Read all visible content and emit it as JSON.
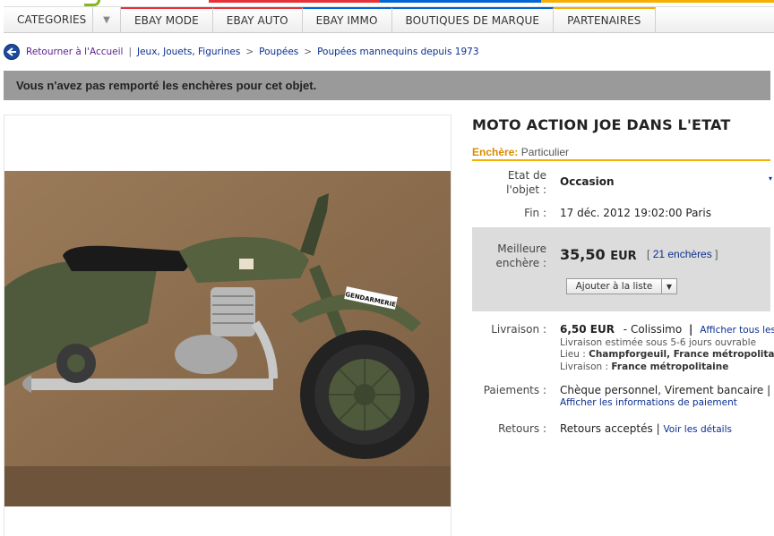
{
  "colors": {
    "ebay_red": "#e53238",
    "ebay_blue": "#0064d2",
    "ebay_yellow": "#f5af02",
    "ebay_green": "#86b817",
    "status_bar": "#9a9a9a",
    "bid_panel": "#dcdcdc",
    "link": "#0b2f8f"
  },
  "nav": {
    "categories": "CATEGORIES",
    "items": [
      "EBAY MODE",
      "EBAY AUTO",
      "EBAY IMMO",
      "BOUTIQUES DE MARQUE",
      "PARTENAIRES"
    ]
  },
  "breadcrumb": {
    "back_label": "Retourner à l'Accueil",
    "separator": ">",
    "path": [
      "Jeux, Jouets, Figurines",
      "Poupées",
      "Poupées mannequins depuis 1973"
    ]
  },
  "status_message": "Vous n'avez pas remporté les enchères pour cet objet.",
  "item": {
    "title": "MOTO ACTION JOE DANS L'ETAT",
    "seller_label": "Enchère:",
    "seller_type": "Particulier",
    "condition_label": "Etat de l'objet :",
    "condition": "Occasion",
    "end_label": "Fin :",
    "end_date": "17 déc. 2012 19:02:00 Paris",
    "best_bid_label": "Meilleure enchère :",
    "price": "35,50",
    "currency": "EUR",
    "bid_count_prefix": "[",
    "bid_count": "21 enchères",
    "bid_count_suffix": "]",
    "watch_button": "Ajouter à la liste",
    "shipping_label": "Livraison :",
    "shipping_cost": "6,50 EUR",
    "shipping_method": "- Colissimo",
    "shipping_sep": "|",
    "shipping_all": "Afficher tous les",
    "shipping_estimate": "Livraison estimée sous 5-6 jours ouvrable",
    "location_label": "Lieu :",
    "location": "Champforgeuil, France métropolita",
    "delivery_label": "Livraison :",
    "delivery_area": "France métropolitaine",
    "payment_label": "Paiements :",
    "payment_methods": "Chèque personnel, Virement bancaire",
    "payment_sep": "|",
    "payment_link": "Afficher les informations de paiement",
    "returns_label": "Retours :",
    "returns": "Retours acceptés",
    "returns_sep": "|",
    "returns_link": "Voir les détails"
  },
  "photo": {
    "badge_text": "GENDARMERIE"
  }
}
